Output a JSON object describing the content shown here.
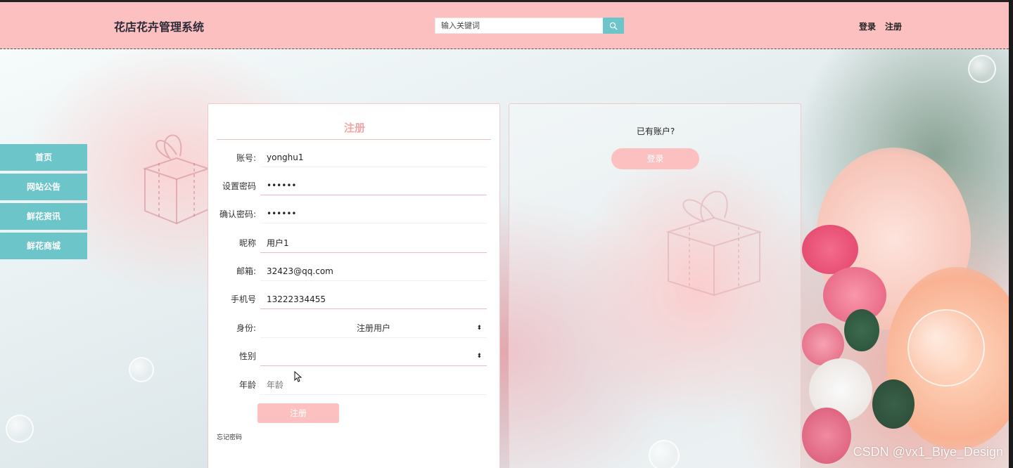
{
  "header": {
    "site_title": "花店花卉管理系统",
    "search_placeholder": "输入关键词",
    "login_link": "登录",
    "register_link": "注册",
    "search_icon": "search-icon"
  },
  "sidebar": {
    "items": [
      {
        "label": "首页"
      },
      {
        "label": "网站公告"
      },
      {
        "label": "鲜花资讯"
      },
      {
        "label": "鲜花商城"
      }
    ]
  },
  "register_form": {
    "title": "注册",
    "fields": {
      "account": {
        "label": "账号:",
        "value": "yonghu1"
      },
      "password": {
        "label": "设置密码",
        "value": "••••••"
      },
      "confirm_password": {
        "label": "确认密码:",
        "value": "••••••"
      },
      "nickname": {
        "label": "昵称",
        "value": "用户1"
      },
      "email": {
        "label": "邮箱:",
        "value": "32423@qq.com"
      },
      "phone": {
        "label": "手机号",
        "value": "13222334455"
      },
      "role": {
        "label": "身份:",
        "value": "注册用户"
      },
      "gender": {
        "label": "性别",
        "value": ""
      },
      "age": {
        "label": "年龄",
        "placeholder": "年龄"
      }
    },
    "submit_label": "注册",
    "forgot_password": "忘记密码"
  },
  "login_side": {
    "prompt": "已有账户?",
    "login_button": "登录"
  },
  "watermark": "CSDN @vx1_Biye_Design",
  "colors": {
    "header_bg": "#fcc0c0",
    "accent_teal": "#6cc5c8",
    "title_pink": "#f4a6a6"
  }
}
